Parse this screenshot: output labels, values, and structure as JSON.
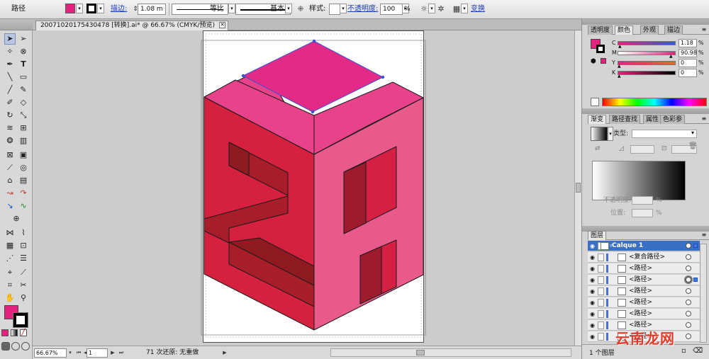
{
  "control_bar": {
    "object_type": "路径",
    "fill_color": "#e3237d",
    "stroke_color": "#000000",
    "stroke_label": "描边:",
    "stroke_weight": "1.08 m",
    "profile_label": "等比",
    "brush_label": "基本",
    "style_label": "样式:",
    "opacity_label": "不透明度:",
    "opacity_value": "100",
    "opacity_unit": "%",
    "transform_label": "变换"
  },
  "document": {
    "tab_title": "20071020175430478 [转换].ai* @ 66.67% (CMYK/预览)",
    "tab_close": "✕"
  },
  "status_bar": {
    "zoom": "66.67%",
    "page": "1",
    "status_text": "71 次还原: 无重做"
  },
  "tools": {
    "fill_color": "#e3237d",
    "stroke_color": "#000000"
  },
  "color_panel": {
    "tabs": [
      "透明度",
      "颜色",
      "外观",
      "描边"
    ],
    "active_tab": "颜色",
    "channels": [
      {
        "letter": "C",
        "value": "1.18",
        "unit": "%",
        "level": 0.012
      },
      {
        "letter": "M",
        "value": "90.98",
        "unit": "%",
        "level": 0.91
      },
      {
        "letter": "Y",
        "value": "0",
        "unit": "%",
        "level": 0
      },
      {
        "letter": "K",
        "value": "0",
        "unit": "%",
        "level": 0
      }
    ]
  },
  "gradient_panel": {
    "tabs": [
      "渐变",
      "路径查找",
      "属性",
      "色彩参"
    ],
    "active_tab": "渐变",
    "type_label": "类型:",
    "opacity_label": "不透明度:",
    "position_label": "位置:",
    "pct": "%"
  },
  "layers_panel": {
    "title": "图层",
    "layers": [
      {
        "name": "Calque 1",
        "level": 0,
        "selected": true
      },
      {
        "name": "<复合路径>",
        "level": 1
      },
      {
        "name": "<路径>",
        "level": 1
      },
      {
        "name": "<路径>",
        "level": 1,
        "targeted": true
      },
      {
        "name": "<路径>",
        "level": 1
      },
      {
        "name": "<路径>",
        "level": 1
      },
      {
        "name": "<路径>",
        "level": 1
      },
      {
        "name": "<路径>",
        "level": 1
      },
      {
        "name": "<路径>",
        "level": 1
      }
    ],
    "footer_text": "1 个图层"
  },
  "watermark": {
    "text": "云南龙网"
  },
  "artwork": {
    "colors": {
      "top_face": "#e22a86",
      "left_outer": "#d5213f",
      "left_inner": "#a81d2a",
      "left_shadow": "#8f1a22",
      "right_face": "#e95a8c",
      "right_inner": "#d51f43",
      "right_dark": "#9e1b2e",
      "top_outer": "#e8438a",
      "outline": "#1a1a1a",
      "path_handle": "#3a4fd8"
    }
  }
}
